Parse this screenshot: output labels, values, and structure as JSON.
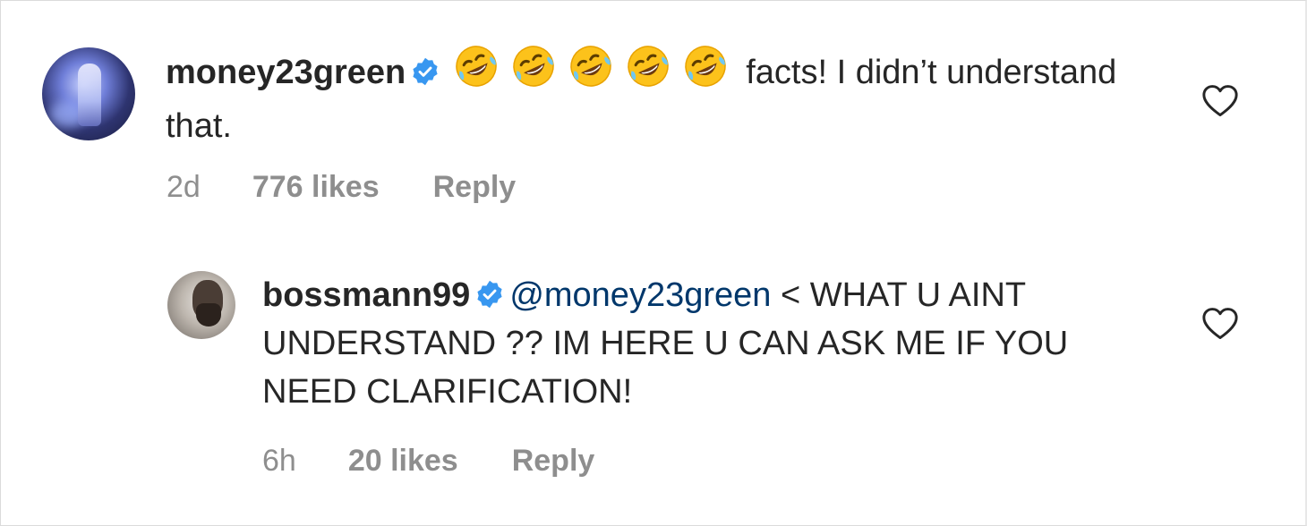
{
  "comments": [
    {
      "username": "money23green",
      "verified": true,
      "emoji_count": 5,
      "text": "facts! I didn’t understand that.",
      "time": "2d",
      "likes": "776 likes",
      "reply_label": "Reply",
      "icons": {
        "verified": "verified-badge-icon",
        "like": "heart-outline-icon",
        "emoji": "rolling-on-floor-laughing-emoji"
      }
    },
    {
      "username": "bossmann99",
      "verified": true,
      "mention": "@money23green",
      "text": "< WHAT U AINT UNDERSTAND ?? IM HERE U CAN ASK ME IF YOU NEED CLARIFICATION!",
      "time": "6h",
      "likes": "20 likes",
      "reply_label": "Reply",
      "icons": {
        "verified": "verified-badge-icon",
        "like": "heart-outline-icon"
      }
    }
  ],
  "colors": {
    "text": "#262626",
    "meta": "#8e8e8e",
    "mention": "#00376b",
    "verified": "#3897f0"
  }
}
